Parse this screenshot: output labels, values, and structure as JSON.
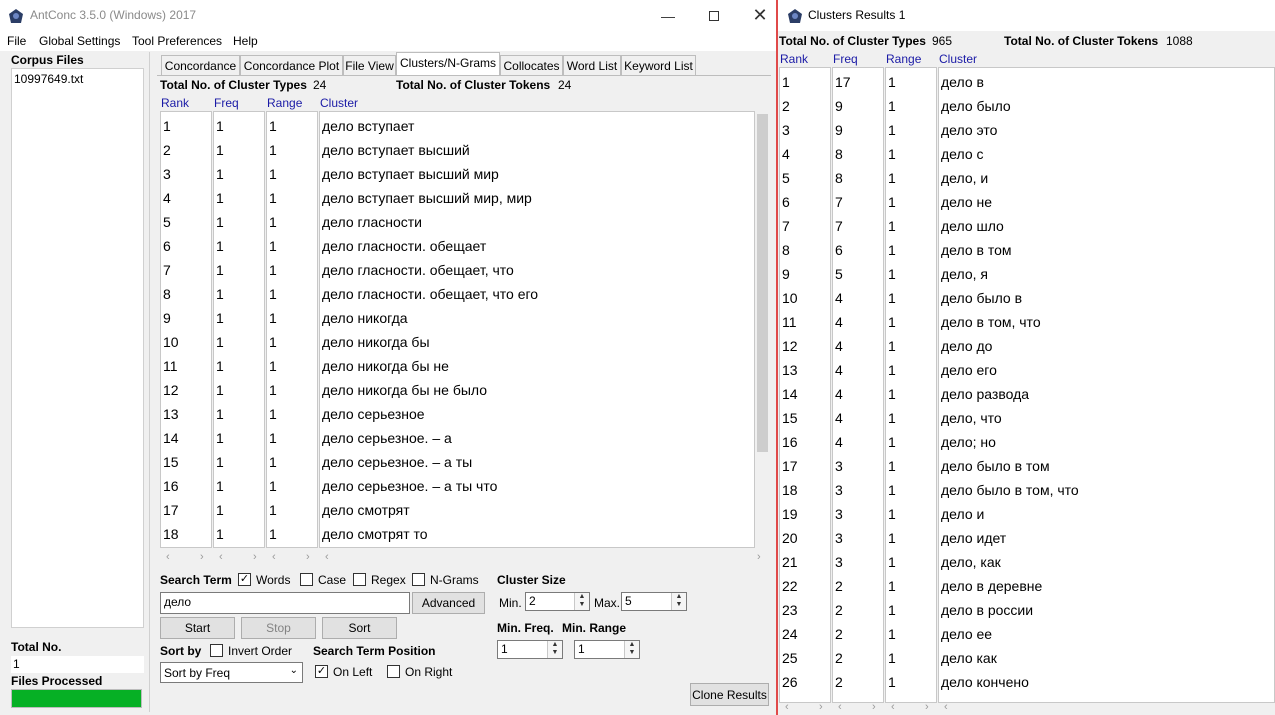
{
  "main_window": {
    "title": "AntConc 3.5.0 (Windows) 2017",
    "menu": [
      "File",
      "Global Settings",
      "Tool Preferences",
      "Help"
    ],
    "corpus_files_label": "Corpus Files",
    "corpus_files": [
      "10997649.txt"
    ],
    "total_no_label": "Total No.",
    "total_no_value": "1",
    "files_processed_label": "Files Processed",
    "files_processed_progress": 1.0,
    "tabs": [
      "Concordance",
      "Concordance Plot",
      "File View",
      "Clusters/N-Grams",
      "Collocates",
      "Word List",
      "Keyword List"
    ],
    "active_tab": "Clusters/N-Grams",
    "cluster_types_label": "Total No. of Cluster Types",
    "cluster_types_value": "24",
    "cluster_tokens_label": "Total No. of Cluster Tokens",
    "cluster_tokens_value": "24",
    "columns": [
      "Rank",
      "Freq",
      "Range",
      "Cluster"
    ],
    "rows": [
      [
        "1",
        "1",
        "1",
        "дело вступает"
      ],
      [
        "2",
        "1",
        "1",
        "дело вступает высший"
      ],
      [
        "3",
        "1",
        "1",
        "дело вступает высший мир"
      ],
      [
        "4",
        "1",
        "1",
        "дело вступает высший мир, мир"
      ],
      [
        "5",
        "1",
        "1",
        "дело гласности"
      ],
      [
        "6",
        "1",
        "1",
        "дело гласности. обещает"
      ],
      [
        "7",
        "1",
        "1",
        "дело гласности. обещает, что"
      ],
      [
        "8",
        "1",
        "1",
        "дело гласности. обещает, что его"
      ],
      [
        "9",
        "1",
        "1",
        "дело никогда"
      ],
      [
        "10",
        "1",
        "1",
        "дело никогда бы"
      ],
      [
        "11",
        "1",
        "1",
        "дело никогда бы не"
      ],
      [
        "12",
        "1",
        "1",
        "дело никогда бы не было"
      ],
      [
        "13",
        "1",
        "1",
        "дело серьезное"
      ],
      [
        "14",
        "1",
        "1",
        "дело серьезное.  – а"
      ],
      [
        "15",
        "1",
        "1",
        "дело серьезное.  – а ты"
      ],
      [
        "16",
        "1",
        "1",
        "дело серьезное.  – а ты что"
      ],
      [
        "17",
        "1",
        "1",
        "дело смотрят"
      ],
      [
        "18",
        "1",
        "1",
        "дело смотрят то"
      ]
    ],
    "search_term_label": "Search Term",
    "opt_words": "Words",
    "opt_case": "Case",
    "opt_regex": "Regex",
    "opt_ngrams": "N-Grams",
    "search_value": "дело",
    "advanced_label": "Advanced",
    "start_label": "Start",
    "stop_label": "Stop",
    "sort_label": "Sort",
    "cluster_size_label": "Cluster Size",
    "min_label": "Min.",
    "min_value": "2",
    "max_label": "Max.",
    "max_value": "5",
    "min_freq_label": "Min. Freq.",
    "min_freq_value": "1",
    "min_range_label": "Min. Range",
    "min_range_value": "1",
    "sort_by_label": "Sort by",
    "invert_order_label": "Invert Order",
    "sort_by_value": "Sort by Freq",
    "search_term_position_label": "Search Term Position",
    "on_left_label": "On Left",
    "on_right_label": "On Right",
    "clone_results_label": "Clone Results"
  },
  "results_window": {
    "title": "Clusters Results 1",
    "cluster_types_label": "Total No. of Cluster Types",
    "cluster_types_value": "965",
    "cluster_tokens_label": "Total No. of Cluster Tokens",
    "cluster_tokens_value": "1088",
    "columns": [
      "Rank",
      "Freq",
      "Range",
      "Cluster"
    ],
    "rows": [
      [
        "1",
        "17",
        "1",
        "дело в"
      ],
      [
        "2",
        "9",
        "1",
        "дело было"
      ],
      [
        "3",
        "9",
        "1",
        "дело это"
      ],
      [
        "4",
        "8",
        "1",
        "дело с"
      ],
      [
        "5",
        "8",
        "1",
        "дело, и"
      ],
      [
        "6",
        "7",
        "1",
        "дело не"
      ],
      [
        "7",
        "7",
        "1",
        "дело шло"
      ],
      [
        "8",
        "6",
        "1",
        "дело в том"
      ],
      [
        "9",
        "5",
        "1",
        "дело, я"
      ],
      [
        "10",
        "4",
        "1",
        "дело было в"
      ],
      [
        "11",
        "4",
        "1",
        "дело в том, что"
      ],
      [
        "12",
        "4",
        "1",
        "дело до"
      ],
      [
        "13",
        "4",
        "1",
        "дело его"
      ],
      [
        "14",
        "4",
        "1",
        "дело развода"
      ],
      [
        "15",
        "4",
        "1",
        "дело, что"
      ],
      [
        "16",
        "4",
        "1",
        "дело; но"
      ],
      [
        "17",
        "3",
        "1",
        "дело было в том"
      ],
      [
        "18",
        "3",
        "1",
        "дело было в том, что"
      ],
      [
        "19",
        "3",
        "1",
        "дело и"
      ],
      [
        "20",
        "3",
        "1",
        "дело идет"
      ],
      [
        "21",
        "3",
        "1",
        "дело, как"
      ],
      [
        "22",
        "2",
        "1",
        "дело в деревне"
      ],
      [
        "23",
        "2",
        "1",
        "дело в россии"
      ],
      [
        "24",
        "2",
        "1",
        "дело ее"
      ],
      [
        "25",
        "2",
        "1",
        "дело как"
      ],
      [
        "26",
        "2",
        "1",
        "дело кончено"
      ]
    ]
  },
  "colors": {
    "header_blue": "#1a1aa6",
    "progress_green": "#06b025",
    "results_border": "#e04a4a"
  }
}
